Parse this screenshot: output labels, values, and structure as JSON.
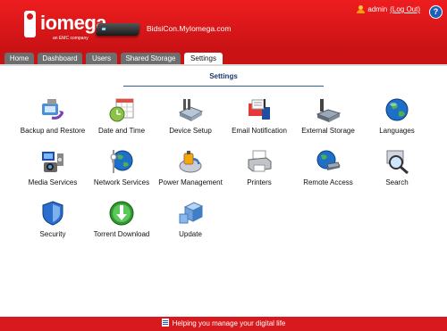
{
  "header": {
    "logo_word": "iomega",
    "logo_sub": "an EMC company",
    "hostname": "BidsiCon.MyIomega.com",
    "user": "admin",
    "logout_label": "(Log Out)",
    "help_label": "?"
  },
  "tabs": [
    {
      "label": "Home"
    },
    {
      "label": "Dashboard"
    },
    {
      "label": "Users"
    },
    {
      "label": "Shared Storage"
    },
    {
      "label": "Settings",
      "active": true
    }
  ],
  "page_title": "Settings",
  "settings": [
    {
      "label": "Backup and Restore",
      "icon": "backup-restore-icon"
    },
    {
      "label": "Date and Time",
      "icon": "date-time-icon"
    },
    {
      "label": "Device Setup",
      "icon": "device-setup-icon"
    },
    {
      "label": "Email Notification",
      "icon": "email-notification-icon"
    },
    {
      "label": "External Storage",
      "icon": "external-storage-icon"
    },
    {
      "label": "Languages",
      "icon": "languages-icon"
    },
    {
      "label": "Media Services",
      "icon": "media-services-icon"
    },
    {
      "label": "Network Services",
      "icon": "network-services-icon"
    },
    {
      "label": "Power Management",
      "icon": "power-management-icon"
    },
    {
      "label": "Printers",
      "icon": "printers-icon"
    },
    {
      "label": "Remote Access",
      "icon": "remote-access-icon"
    },
    {
      "label": "Search",
      "icon": "search-icon"
    },
    {
      "label": "Security",
      "icon": "security-icon"
    },
    {
      "label": "Torrent Download",
      "icon": "torrent-download-icon"
    },
    {
      "label": "Update",
      "icon": "update-icon"
    }
  ],
  "footer": {
    "text": "Helping you manage your digital life"
  },
  "colors": {
    "brand_red": "#d81a1e",
    "tab_gray": "#6e6e6e",
    "title_blue": "#1a3a6a"
  }
}
